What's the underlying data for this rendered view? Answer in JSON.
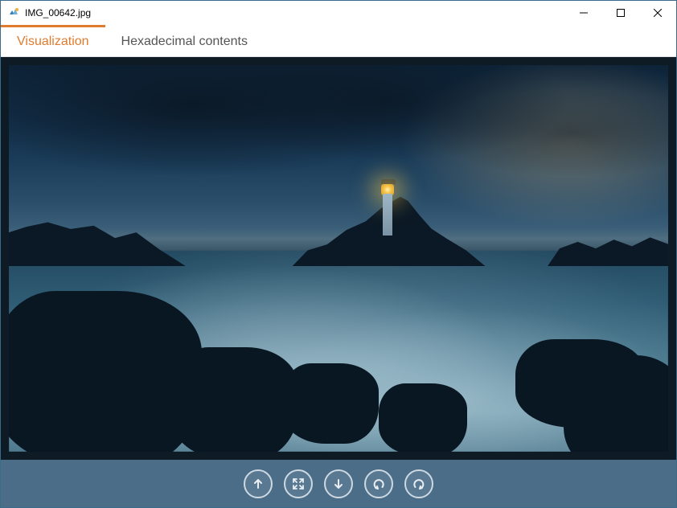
{
  "window": {
    "title": "IMG_00642.jpg"
  },
  "tabs": {
    "visualization": "Visualization",
    "hexadecimal": "Hexadecimal contents",
    "active": "visualization"
  },
  "toolbar": {
    "buttons": {
      "upload": "arrow-up",
      "fullscreen": "expand",
      "download": "arrow-down",
      "undo": "undo",
      "redo": "redo"
    }
  },
  "colors": {
    "accent": "#e07b2e",
    "toolbar_bg": "#4b6d88"
  }
}
